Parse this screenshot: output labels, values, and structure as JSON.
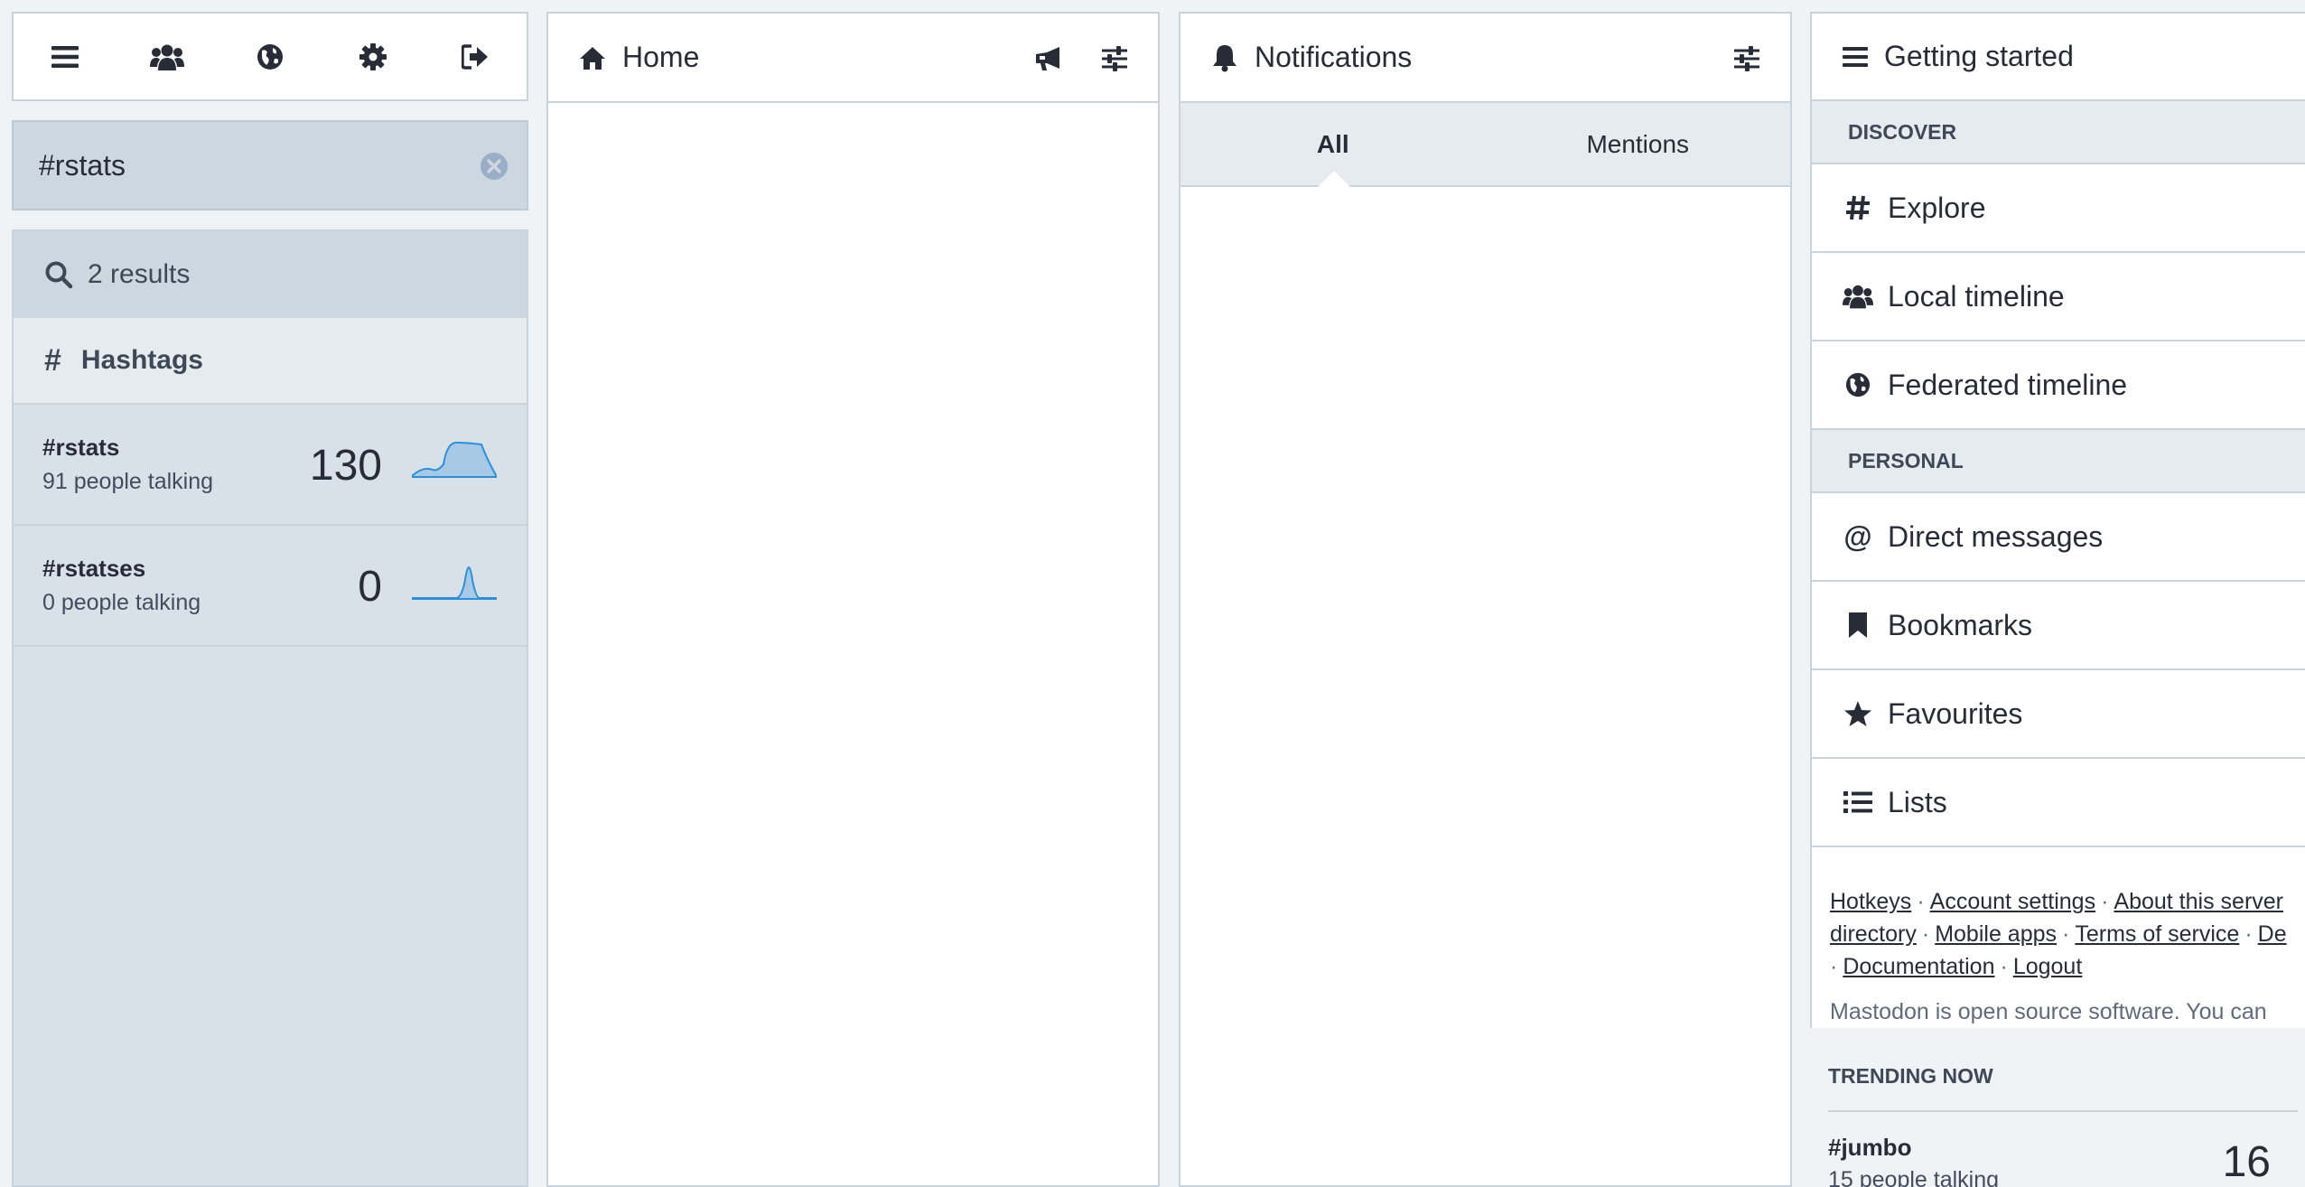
{
  "drawer": {
    "icons": [
      "menu-icon",
      "users-icon",
      "globe-icon",
      "gear-icon",
      "logout-icon"
    ],
    "search": {
      "value": "#rstats"
    },
    "results": {
      "count_label": "2 results",
      "section_label": "Hashtags",
      "hashtags": [
        {
          "name": "#rstats",
          "people": "91 people talking",
          "count": "130"
        },
        {
          "name": "#rstatses",
          "people": "0 people talking",
          "count": "0"
        }
      ]
    }
  },
  "home": {
    "title": "Home"
  },
  "notifications": {
    "title": "Notifications",
    "tabs": [
      "All",
      "Mentions"
    ]
  },
  "getting_started": {
    "title": "Getting started",
    "discover_label": "DISCOVER",
    "discover_items": [
      "Explore",
      "Local timeline",
      "Federated timeline"
    ],
    "personal_label": "PERSONAL",
    "personal_items": [
      "Direct messages",
      "Bookmarks",
      "Favourites",
      "Lists"
    ],
    "footer_links": [
      "Hotkeys",
      "Account settings",
      "About this server",
      "directory",
      "Mobile apps",
      "Terms of service",
      "De",
      "Documentation",
      "Logout"
    ],
    "footer_text": "Mastodon is open source software. You can",
    "trending_title": "TRENDING NOW",
    "trending": [
      {
        "name": "#jumbo",
        "people": "15 people talking",
        "count": "16"
      }
    ]
  },
  "colors": {
    "accent": "#2b90d9",
    "panel": "#d9e1e8",
    "text": "#282c37"
  }
}
